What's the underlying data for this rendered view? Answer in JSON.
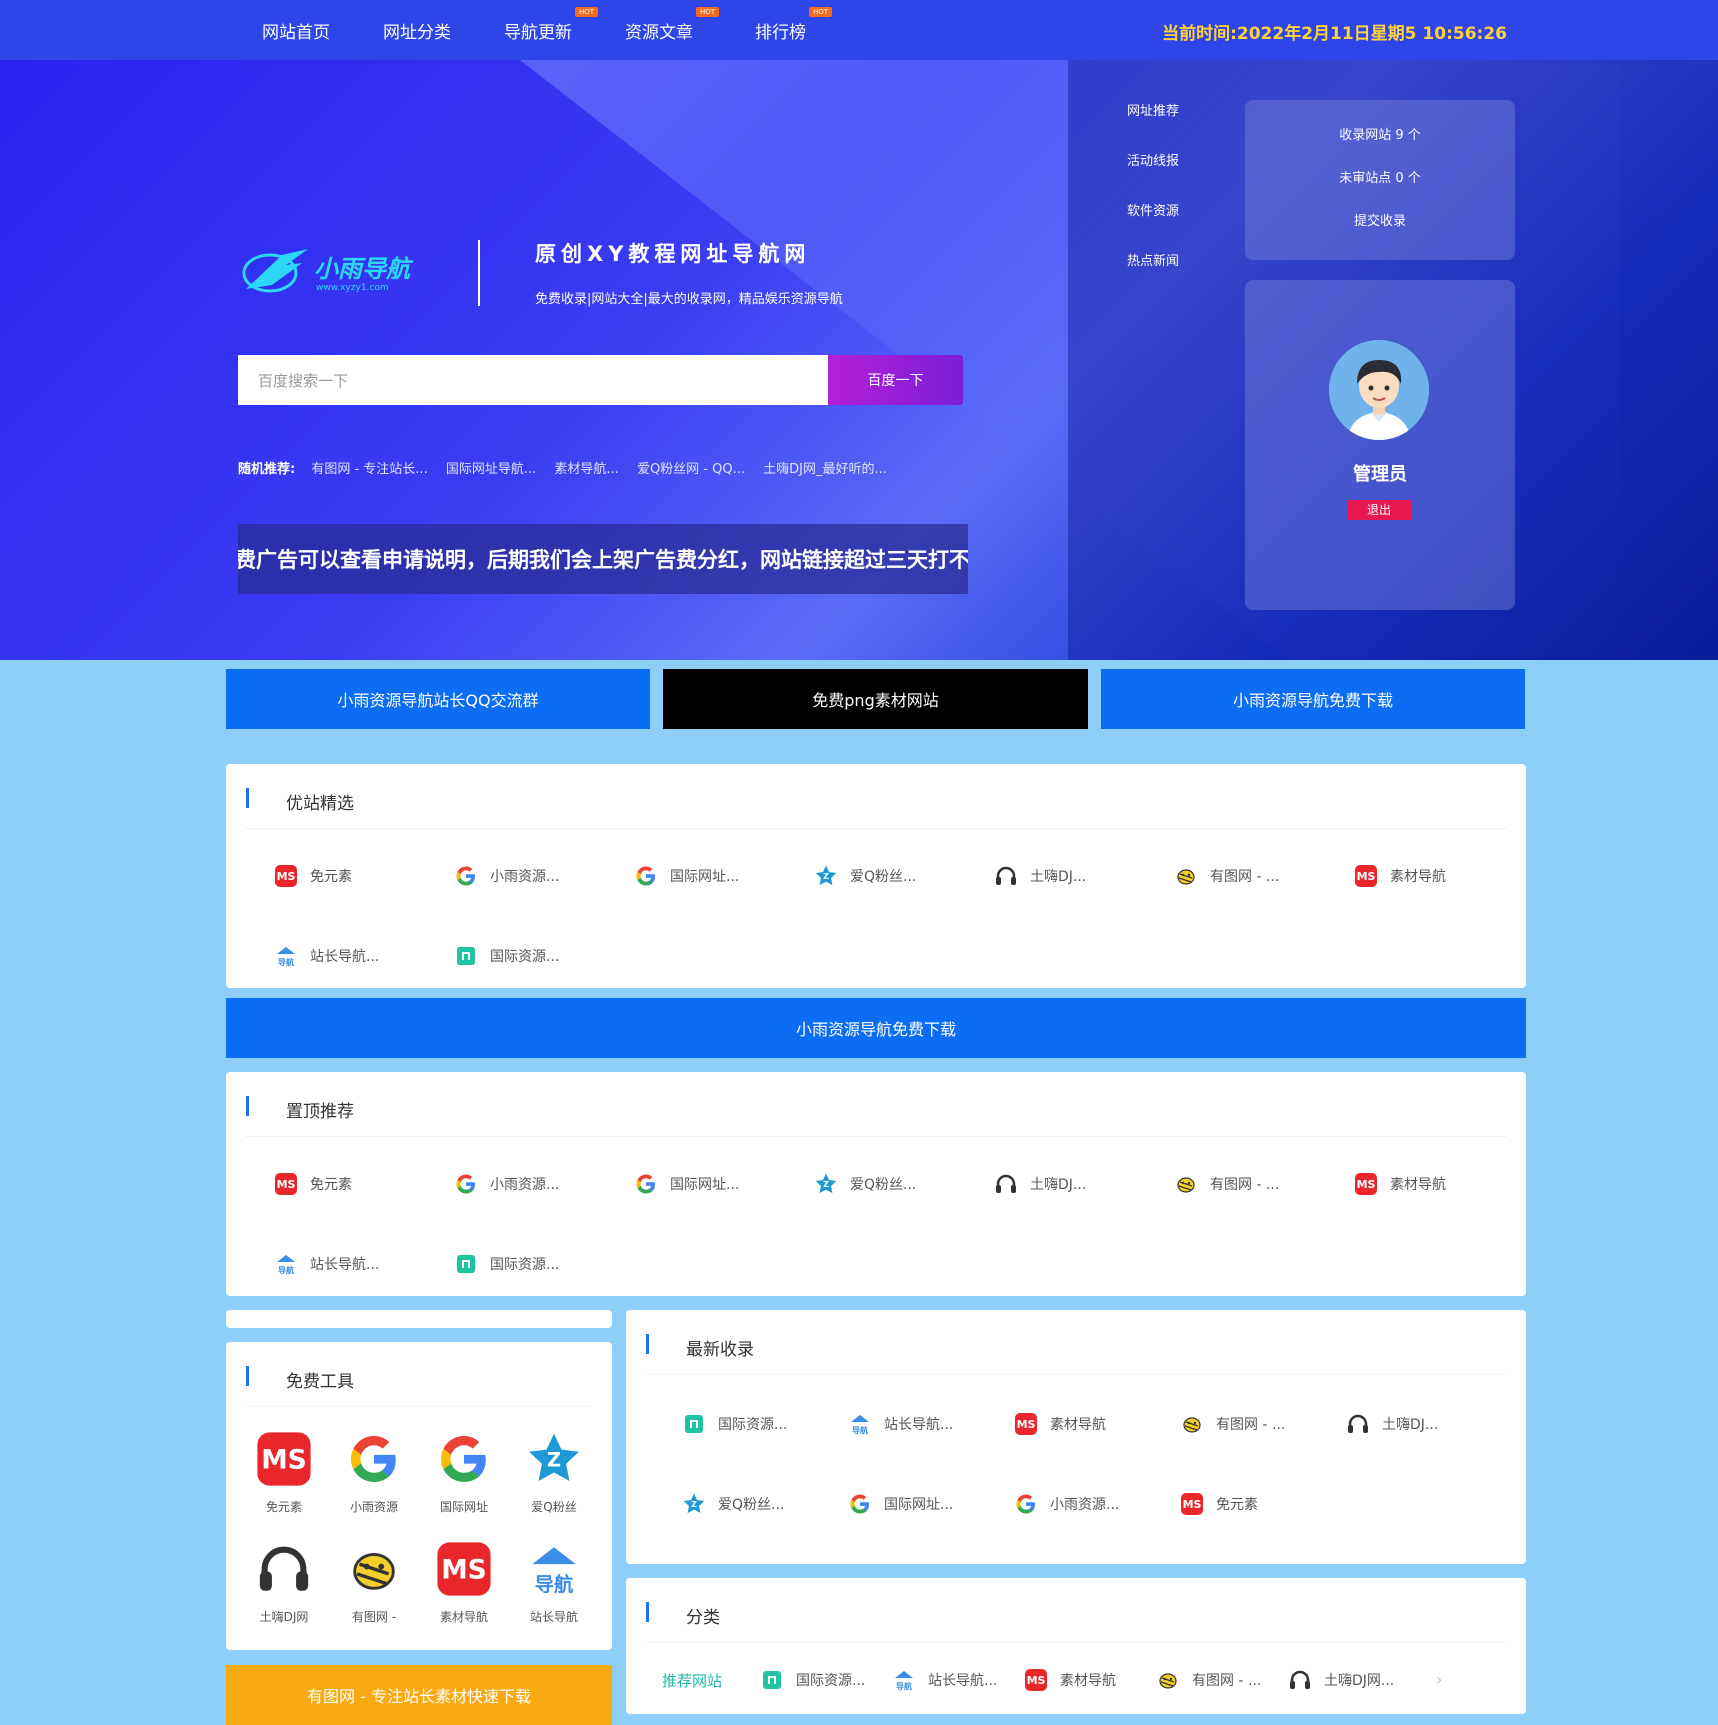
{
  "nav": {
    "items": [
      {
        "label": "网站首页",
        "hot": false
      },
      {
        "label": "网址分类",
        "hot": false
      },
      {
        "label": "导航更新",
        "hot": true
      },
      {
        "label": "资源文章",
        "hot": true
      },
      {
        "label": "排行榜",
        "hot": true
      }
    ],
    "hot_label": "HOT",
    "clock": "当前时间:2022年2月11日星期5 10:56:26"
  },
  "hero": {
    "logo_text": "小雨导航",
    "logo_url": "www.xyzy1.com",
    "title": "原创XY教程网址导航网",
    "subtitle": "免费收录|网站大全|最大的收录网，精品娱乐资源导航",
    "search_placeholder": "百度搜索一下",
    "search_button": "百度一下",
    "random_label": "随机推荐:",
    "random_links": [
      "有图网 - 专注站长...",
      "国际网址导航...",
      "素材导航...",
      "爱Q粉丝网 - QQ...",
      "土嗨DJ网_最好听的..."
    ],
    "marquee": "免费广告可以查看申请说明，后期我们会上架广告费分红，网站链接超过三天打不开"
  },
  "side_links": [
    "网址推荐",
    "活动线报",
    "软件资源",
    "热点新闻"
  ],
  "stats": {
    "sites": "收录网站 9 个",
    "pending": "未审站点 0 个",
    "submit": "提交收录"
  },
  "user": {
    "name": "管理员",
    "logout": "退出"
  },
  "banners": [
    {
      "label": "小雨资源导航站长QQ交流群",
      "color": "#0b6cf4"
    },
    {
      "label": "免费png素材网站",
      "color": "#000000"
    },
    {
      "label": "小雨资源导航免费下载",
      "color": "#0b6cf4"
    }
  ],
  "featured": {
    "title": "优站精选",
    "items": [
      {
        "label": "免元素",
        "icon": "mis-icon"
      },
      {
        "label": "小雨资源...",
        "icon": "google-icon"
      },
      {
        "label": "国际网址...",
        "icon": "google-icon"
      },
      {
        "label": "爱Q粉丝...",
        "icon": "star-icon"
      },
      {
        "label": "土嗨DJ...",
        "icon": "headphones-icon"
      },
      {
        "label": "有图网 - ...",
        "icon": "bee-icon"
      },
      {
        "label": "素材导航",
        "icon": "mis-icon"
      },
      {
        "label": "站长导航...",
        "icon": "nav-house-icon"
      },
      {
        "label": "国际资源...",
        "icon": "green-box-icon"
      }
    ]
  },
  "download_banner": "小雨资源导航免费下载",
  "pinned": {
    "title": "置顶推荐",
    "items": [
      {
        "label": "免元素",
        "icon": "mis-icon"
      },
      {
        "label": "小雨资源...",
        "icon": "google-icon"
      },
      {
        "label": "国际网址...",
        "icon": "google-icon"
      },
      {
        "label": "爱Q粉丝...",
        "icon": "star-icon"
      },
      {
        "label": "土嗨DJ...",
        "icon": "headphones-icon"
      },
      {
        "label": "有图网 - ...",
        "icon": "bee-icon"
      },
      {
        "label": "素材导航",
        "icon": "mis-icon"
      },
      {
        "label": "站长导航...",
        "icon": "nav-house-icon"
      },
      {
        "label": "国际资源...",
        "icon": "green-box-icon"
      }
    ]
  },
  "tools": {
    "title": "免费工具",
    "items": [
      {
        "label": "免元素",
        "icon": "mis-icon"
      },
      {
        "label": "小雨资源",
        "icon": "google-icon"
      },
      {
        "label": "国际网址",
        "icon": "google-icon"
      },
      {
        "label": "爱Q粉丝",
        "icon": "star-icon"
      },
      {
        "label": "土嗨DJ网",
        "icon": "headphones-icon"
      },
      {
        "label": "有图网 -",
        "icon": "bee-icon"
      },
      {
        "label": "素材导航",
        "icon": "mis-icon"
      },
      {
        "label": "站长导航",
        "icon": "nav-house-icon"
      }
    ]
  },
  "latest": {
    "title": "最新收录",
    "items": [
      {
        "label": "国际资源...",
        "icon": "green-box-icon"
      },
      {
        "label": "站长导航...",
        "icon": "nav-house-icon"
      },
      {
        "label": "素材导航",
        "icon": "mis-icon"
      },
      {
        "label": "有图网 - ...",
        "icon": "bee-icon"
      },
      {
        "label": "土嗨DJ...",
        "icon": "headphones-icon"
      },
      {
        "label": "爱Q粉丝...",
        "icon": "star-icon"
      },
      {
        "label": "国际网址...",
        "icon": "google-icon"
      },
      {
        "label": "小雨资源...",
        "icon": "google-icon"
      },
      {
        "label": "免元素",
        "icon": "mis-icon"
      }
    ]
  },
  "category": {
    "title": "分类",
    "tab": "推荐网站",
    "items": [
      {
        "label": "国际资源...",
        "icon": "green-box-icon"
      },
      {
        "label": "站长导航...",
        "icon": "nav-house-icon"
      },
      {
        "label": "素材导航",
        "icon": "mis-icon"
      },
      {
        "label": "有图网 - ...",
        "icon": "bee-icon"
      },
      {
        "label": "土嗨DJ网...",
        "icon": "headphones-icon"
      }
    ]
  },
  "bottom_banner": "有图网 - 专注站长素材快速下载",
  "colors": {
    "accent": "#0b6cf4",
    "page_bg": "#8ecff7",
    "nav_bg": "#2e45e8",
    "clock": "#ffd23a",
    "logout": "#e8174f",
    "orange": "#f9a912",
    "category_tab": "#1fb7a6"
  }
}
